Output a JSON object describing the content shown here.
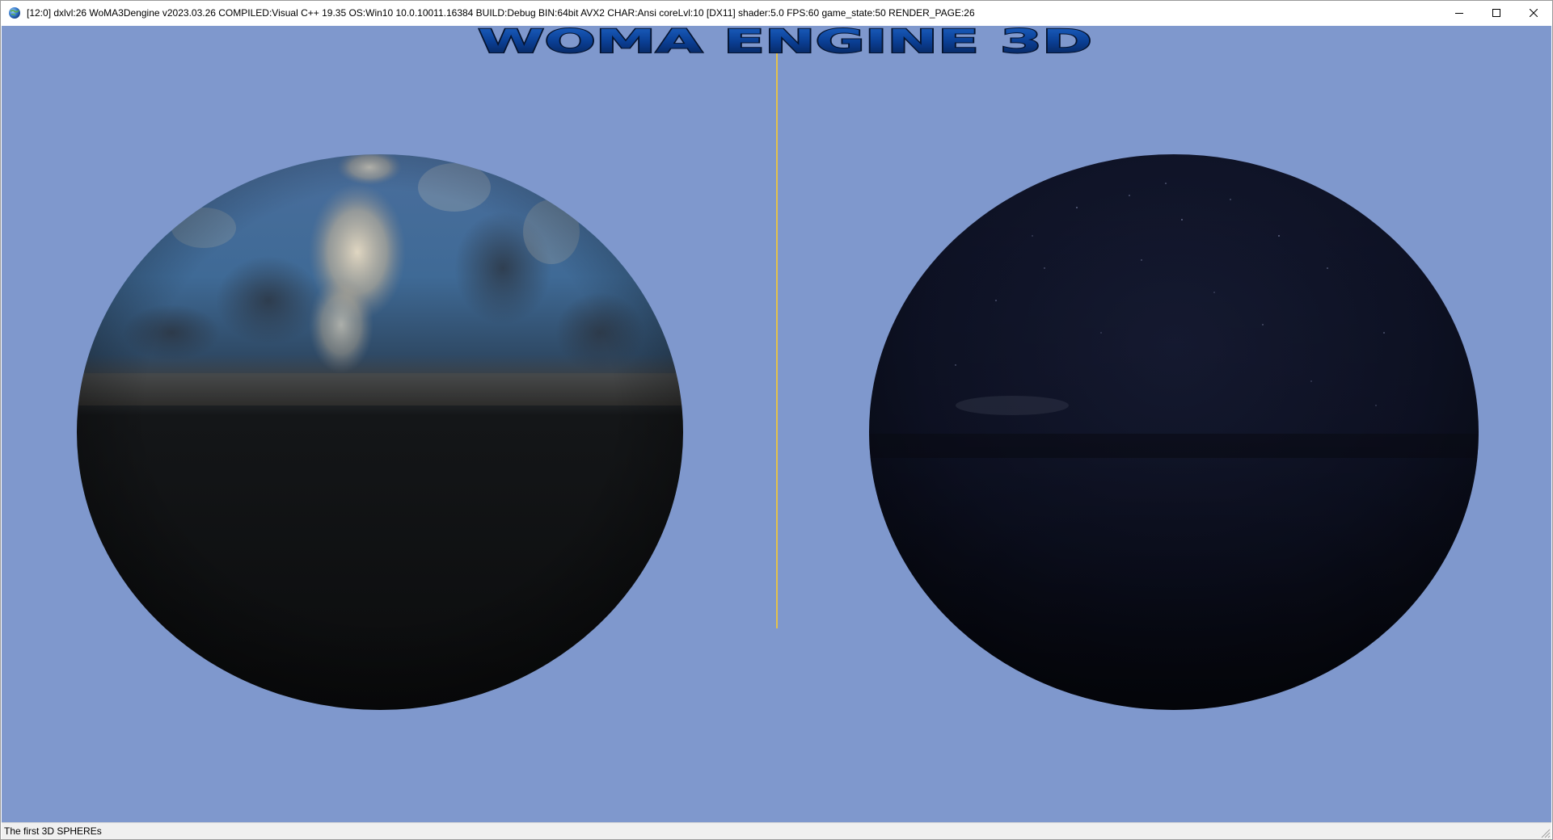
{
  "window": {
    "title": "[12:0] dxlvl:26 WoMA3Dengine v2023.03.26 COMPILED:Visual C++ 19.35 OS:Win10 10.0.10011.16384 BUILD:Debug BIN:64bit AVX2 CHAR:Ansi coreLvl:10 [DX11] shader:5.0 FPS:60 game_state:50 RENDER_PAGE:26",
    "app_icon": "globe-icon",
    "controls": {
      "minimize_icon": "minimize-icon",
      "maximize_icon": "maximize-icon",
      "close_icon": "close-icon"
    }
  },
  "scene": {
    "logo_text": "WOMA ENGINE 3D",
    "background_color": "#7f98cd",
    "divider_color": "#e5c24a",
    "logo_color": "#0a3e93",
    "spheres": [
      {
        "name": "day sky sphere",
        "texture": "daytime sky with clouds"
      },
      {
        "name": "night sky sphere",
        "texture": "night sky with stars"
      }
    ]
  },
  "statusbar": {
    "text": "The first 3D SPHEREs"
  }
}
